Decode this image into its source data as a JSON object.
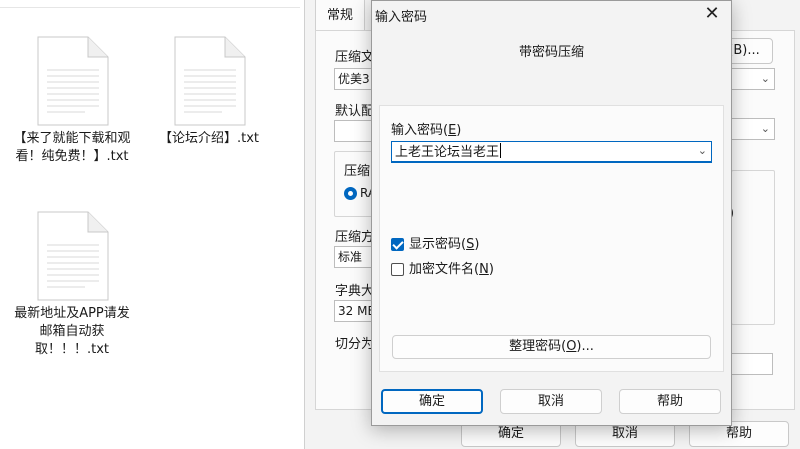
{
  "desktop": {
    "files": [
      {
        "name": "【来了就能下载和观看！纯免费！】.txt"
      },
      {
        "name": "【论坛介绍】.txt"
      },
      {
        "name": "最新地址及APP请发邮箱自动获取！！！.txt"
      }
    ]
  },
  "bg_dialog": {
    "tab_general": "常规",
    "archive_name_label": "压缩文",
    "browse_button": "(B)...",
    "profile_value": "优美3",
    "default_profile_label": "默认配",
    "format_group_label": "压缩",
    "format_radio_label": "RA",
    "method_label": "压缩方",
    "method_value": "标准",
    "dict_label": "字典大",
    "dict_value": "32 MB",
    "split_label": "切分为",
    "options_fragment": ")",
    "ok": "确定",
    "cancel": "取消",
    "help": "帮助"
  },
  "pw_dialog": {
    "title": "输入密码",
    "close_glyph": "✕",
    "header": "带密码压缩",
    "label_prefix": "输入密码(",
    "label_key": "E",
    "label_suffix": ")",
    "password_value": "上老王论坛当老王",
    "show_prefix": "显示密码(",
    "show_key": "S",
    "show_suffix": ")",
    "show_checked": true,
    "encrypt_prefix": "加密文件名(",
    "encrypt_key": "N",
    "encrypt_suffix": ")",
    "encrypt_checked": false,
    "manage_prefix": "整理密码(",
    "manage_key": "O",
    "manage_suffix": ")...",
    "ok": "确定",
    "cancel": "取消",
    "help": "帮助"
  },
  "colors": {
    "accent": "#0067c0",
    "dialog_bg": "#f3f3f3",
    "panel_bg": "#fbfbfb"
  },
  "icons": {
    "file": "text-document-icon",
    "close": "close-icon",
    "dropdown": "chevron-down-icon"
  }
}
